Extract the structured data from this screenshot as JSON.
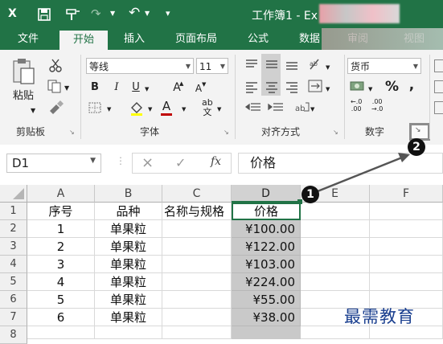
{
  "title_bar": {
    "title": "工作簿1 - Ex",
    "app_icon": "X",
    "undo_icon": "↶"
  },
  "tabs": [
    {
      "label": "文件"
    },
    {
      "label": "开始"
    },
    {
      "label": "插入"
    },
    {
      "label": "页面布局"
    },
    {
      "label": "公式"
    },
    {
      "label": "数据"
    },
    {
      "label": "审阅"
    },
    {
      "label": "视图"
    }
  ],
  "ribbon": {
    "clipboard": {
      "paste_label": "粘贴",
      "group_label": "剪贴板"
    },
    "font": {
      "font_name": "等线",
      "font_size": "11",
      "bold": "B",
      "italic": "I",
      "underline": "U",
      "grow": "A",
      "shrink": "A",
      "font_color": "A",
      "group_label": "字体"
    },
    "alignment": {
      "group_label": "对齐方式"
    },
    "number": {
      "format": "货币",
      "percent": "%",
      "comma": ",",
      "group_label": "数字"
    }
  },
  "formula_bar": {
    "name_box": "D1",
    "fx": "fx",
    "cancel": "×",
    "confirm": "✓",
    "content": "价格"
  },
  "columns": [
    "A",
    "B",
    "C",
    "D",
    "E",
    "F"
  ],
  "rows": [
    "1",
    "2",
    "3",
    "4",
    "5",
    "6",
    "7",
    "8"
  ],
  "table": {
    "headers": [
      "序号",
      "品种",
      "名称与规格",
      "价格"
    ],
    "rows": [
      [
        "1",
        "单果粒",
        "",
        "¥100.00"
      ],
      [
        "2",
        "单果粒",
        "",
        "¥122.00"
      ],
      [
        "3",
        "单果粒",
        "",
        "¥103.00"
      ],
      [
        "4",
        "单果粒",
        "",
        "¥224.00"
      ],
      [
        "5",
        "单果粒",
        "",
        "¥55.00"
      ],
      [
        "6",
        "单果粒",
        "",
        "¥38.00"
      ]
    ]
  },
  "annotations": {
    "step1": "1",
    "step2": "2"
  },
  "watermark": "最需教育",
  "colors": {
    "excel_green": "#217346",
    "selection": "#bfbfbf"
  }
}
